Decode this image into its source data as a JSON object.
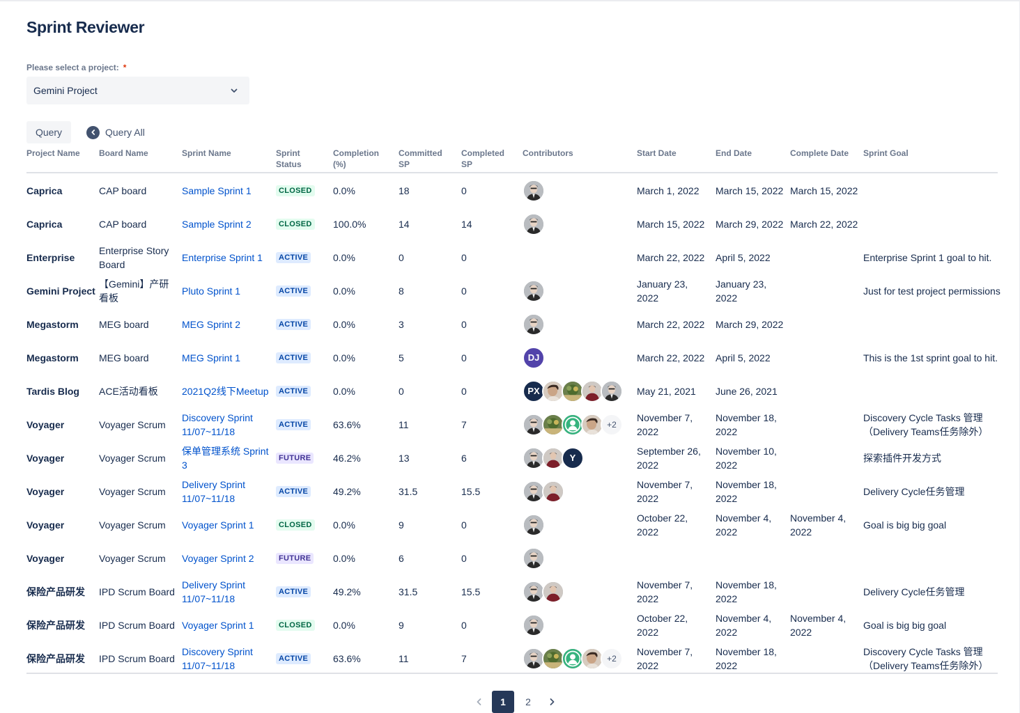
{
  "title": "Sprint Reviewer",
  "project_select": {
    "label": "Please select a project:",
    "required_mark": "*",
    "value": "Gemini Project"
  },
  "actions": {
    "query_label": "Query",
    "query_all_label": "Query All"
  },
  "table": {
    "headers": {
      "project_name": "Project Name",
      "board_name": "Board Name",
      "sprint_name": "Sprint Name",
      "sprint_status_1": "Sprint",
      "sprint_status_2": "Status",
      "completion_1": "Completion",
      "completion_2": "(%)",
      "committed_1": "Committed",
      "committed_2": "SP",
      "completed_1": "Completed",
      "completed_2": "SP",
      "contributors": "Contributors",
      "start_date": "Start Date",
      "end_date": "End Date",
      "complete_date": "Complete Date",
      "sprint_goal": "Sprint Goal"
    },
    "rows": [
      {
        "project": "Caprica",
        "board": "CAP board",
        "sprint": "Sample Sprint 1",
        "status": "CLOSED",
        "completion": "0.0%",
        "committed": "18",
        "completed": "0",
        "contributors": [
          {
            "type": "photo"
          }
        ],
        "start": "March 1, 2022",
        "end": "March 15, 2022",
        "complete": "March 15, 2022",
        "goal": ""
      },
      {
        "project": "Caprica",
        "board": "CAP board",
        "sprint": "Sample Sprint 2",
        "status": "CLOSED",
        "completion": "100.0%",
        "committed": "14",
        "completed": "14",
        "contributors": [
          {
            "type": "photo"
          }
        ],
        "start": "March 15, 2022",
        "end": "March 29, 2022",
        "complete": "March 22, 2022",
        "goal": ""
      },
      {
        "project": "Enterprise",
        "board": "Enterprise Story Board",
        "sprint": "Enterprise Sprint 1",
        "status": "ACTIVE",
        "completion": "0.0%",
        "committed": "0",
        "completed": "0",
        "contributors": [],
        "start": "March 22, 2022",
        "end": "April 5, 2022",
        "complete": "",
        "goal": "Enterprise Sprint 1 goal to hit."
      },
      {
        "project": "Gemini Project",
        "board": "【Gemini】产研看板",
        "sprint": "Pluto Sprint 1",
        "status": "ACTIVE",
        "completion": "0.0%",
        "committed": "8",
        "completed": "0",
        "contributors": [
          {
            "type": "photo"
          }
        ],
        "start": "January 23, 2022",
        "end": "January 23, 2022",
        "complete": "",
        "goal": "Just for test project permissions"
      },
      {
        "project": "Megastorm",
        "board": "MEG board",
        "sprint": "MEG Sprint 2",
        "status": "ACTIVE",
        "completion": "0.0%",
        "committed": "3",
        "completed": "0",
        "contributors": [
          {
            "type": "photo"
          }
        ],
        "start": "March 22, 2022",
        "end": "March 29, 2022",
        "complete": "",
        "goal": ""
      },
      {
        "project": "Megastorm",
        "board": "MEG board",
        "sprint": "MEG Sprint 1",
        "status": "ACTIVE",
        "completion": "0.0%",
        "committed": "5",
        "completed": "0",
        "contributors": [
          {
            "type": "initials",
            "text": "DJ",
            "color": "#5243aa"
          }
        ],
        "start": "March 22, 2022",
        "end": "April 5, 2022",
        "complete": "",
        "goal": "This is the 1st sprint goal to hit."
      },
      {
        "project": "Tardis Blog",
        "board": "ACE活动看板",
        "sprint": "2021Q2线下Meetup",
        "status": "ACTIVE",
        "completion": "0.0%",
        "committed": "0",
        "completed": "0",
        "contributors": [
          {
            "type": "initials",
            "text": "PX",
            "color": "#172b4d"
          },
          {
            "type": "photo2"
          },
          {
            "type": "photo3"
          },
          {
            "type": "photo4"
          },
          {
            "type": "photo"
          }
        ],
        "start": "May 21, 2021",
        "end": "June 26, 2021",
        "complete": "",
        "goal": ""
      },
      {
        "project": "Voyager",
        "board": "Voyager Scrum",
        "sprint": "Discovery Sprint 11/07~11/18",
        "status": "ACTIVE",
        "completion": "63.6%",
        "committed": "11",
        "completed": "7",
        "contributors": [
          {
            "type": "photo"
          },
          {
            "type": "photo3"
          },
          {
            "type": "default"
          },
          {
            "type": "photo2"
          },
          {
            "type": "more",
            "text": "+2"
          }
        ],
        "start": "November 7, 2022",
        "end": "November 18, 2022",
        "complete": "",
        "goal": "Discovery Cycle Tasks 管理（Delivery Teams任务除外）"
      },
      {
        "project": "Voyager",
        "board": "Voyager Scrum",
        "sprint": "保单管理系统 Sprint 3",
        "status": "FUTURE",
        "completion": "46.2%",
        "committed": "13",
        "completed": "6",
        "contributors": [
          {
            "type": "photo"
          },
          {
            "type": "photo4"
          },
          {
            "type": "initials",
            "text": "Y",
            "color": "#172b4d"
          }
        ],
        "start": "September 26, 2022",
        "end": "November 10, 2022",
        "complete": "",
        "goal": "探索插件开发方式"
      },
      {
        "project": "Voyager",
        "board": "Voyager Scrum",
        "sprint": "Delivery Sprint 11/07~11/18",
        "status": "ACTIVE",
        "completion": "49.2%",
        "committed": "31.5",
        "completed": "15.5",
        "contributors": [
          {
            "type": "photo"
          },
          {
            "type": "photo4"
          }
        ],
        "start": "November 7, 2022",
        "end": "November 18, 2022",
        "complete": "",
        "goal": "Delivery Cycle任务管理"
      },
      {
        "project": "Voyager",
        "board": "Voyager Scrum",
        "sprint": "Voyager Sprint 1",
        "status": "CLOSED",
        "completion": "0.0%",
        "committed": "9",
        "completed": "0",
        "contributors": [
          {
            "type": "photo"
          }
        ],
        "start": "October 22, 2022",
        "end": "November 4, 2022",
        "complete": "November 4, 2022",
        "goal": "Goal is big big goal"
      },
      {
        "project": "Voyager",
        "board": "Voyager Scrum",
        "sprint": "Voyager Sprint 2",
        "status": "FUTURE",
        "completion": "0.0%",
        "committed": "6",
        "completed": "0",
        "contributors": [
          {
            "type": "photo"
          }
        ],
        "start": "",
        "end": "",
        "complete": "",
        "goal": ""
      },
      {
        "project": "保险产品研发",
        "board": "IPD Scrum Board",
        "sprint": "Delivery Sprint 11/07~11/18",
        "status": "ACTIVE",
        "completion": "49.2%",
        "committed": "31.5",
        "completed": "15.5",
        "contributors": [
          {
            "type": "photo"
          },
          {
            "type": "photo4"
          }
        ],
        "start": "November 7, 2022",
        "end": "November 18, 2022",
        "complete": "",
        "goal": "Delivery Cycle任务管理"
      },
      {
        "project": "保险产品研发",
        "board": "IPD Scrum Board",
        "sprint": "Voyager Sprint 1",
        "status": "CLOSED",
        "completion": "0.0%",
        "committed": "9",
        "completed": "0",
        "contributors": [
          {
            "type": "photo"
          }
        ],
        "start": "October 22, 2022",
        "end": "November 4, 2022",
        "complete": "November 4, 2022",
        "goal": "Goal is big big goal"
      },
      {
        "project": "保险产品研发",
        "board": "IPD Scrum Board",
        "sprint": "Discovery Sprint 11/07~11/18",
        "status": "ACTIVE",
        "completion": "63.6%",
        "committed": "11",
        "completed": "7",
        "contributors": [
          {
            "type": "photo"
          },
          {
            "type": "photo3"
          },
          {
            "type": "default"
          },
          {
            "type": "photo2"
          },
          {
            "type": "more",
            "text": "+2"
          }
        ],
        "start": "November 7, 2022",
        "end": "November 18, 2022",
        "complete": "",
        "goal": "Discovery Cycle Tasks 管理（Delivery Teams任务除外）"
      }
    ]
  },
  "pagination": {
    "pages": [
      "1",
      "2"
    ],
    "current": "1"
  },
  "colors": {
    "link": "#0052cc",
    "closed_bg": "#e3fcef",
    "active_bg": "#deebff",
    "future_bg": "#eae6ff"
  }
}
